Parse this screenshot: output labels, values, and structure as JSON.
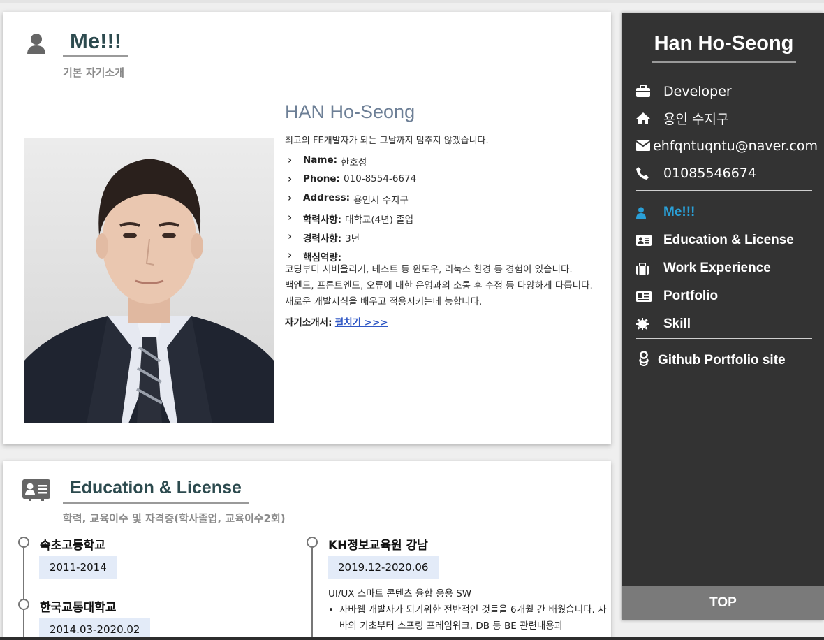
{
  "me_section": {
    "title": "Me!!!",
    "subtitle": "기본 자기소개",
    "intro_name": "HAN Ho-Seong",
    "motto": "최고의 FE개발자가 되는 그날까지 멈추지 않겠습니다.",
    "facts": [
      {
        "key": "Name:",
        "value": "한호성"
      },
      {
        "key": "Phone:",
        "value": "010-8554-6674"
      },
      {
        "key": "Address:",
        "value": "용인시 수지구"
      },
      {
        "key": "학력사항:",
        "value": "대학교(4년) 졸업"
      },
      {
        "key": "경력사항:",
        "value": "3년"
      },
      {
        "key": "핵심역량:",
        "value": ""
      }
    ],
    "core_lines": [
      "코딩부터 서버올리기, 테스트 등 윈도우, 리눅스 환경 등 경험이 있습니다.",
      "백엔드, 프론트엔드, 오류에 대한 운영과의 소통 후 수정 등 다양하게 다룹니다.",
      "새로운 개발지식을 배우고 적용시키는데 능합니다."
    ],
    "self_intro_label": "자기소개서:",
    "self_intro_link": "펼치기 >>>"
  },
  "edu_section": {
    "title": "Education & License",
    "subtitle": "학력, 교육이수 및 자격증(학사졸업, 교육이수2회)",
    "left_items": [
      {
        "title": "속초고등학교",
        "date": "2011-2014"
      },
      {
        "title": "한국교통대학교",
        "date": "2014.03-2020.02"
      }
    ],
    "right_items": [
      {
        "title": "KH정보교육원 강남",
        "date": "2019.12-2020.06",
        "course": "UI/UX 스마트 콘텐츠 융합 응용 SW",
        "bullet": "자바웹 개발자가 되기위한 전반적인 것들을 6개월 간 배웠습니다. 자바의 기초부터 스프링 프레임워크, DB 등 BE 관련내용과"
      }
    ]
  },
  "sidebar": {
    "name": "Han Ho-Seong",
    "info": [
      {
        "icon": "briefcase-icon",
        "text": "Developer"
      },
      {
        "icon": "home-icon",
        "text": "용인 수지구"
      },
      {
        "icon": "envelope-icon",
        "text": "ehfqntuqntu@naver.com"
      },
      {
        "icon": "phone-icon",
        "text": "01085546674"
      }
    ],
    "nav": [
      {
        "icon": "user-icon",
        "label": "Me!!!",
        "active": true
      },
      {
        "icon": "id-card-icon",
        "label": "Education & License",
        "active": false
      },
      {
        "icon": "suitcase-icon",
        "label": "Work Experience",
        "active": false
      },
      {
        "icon": "newspaper-icon",
        "label": "Portfolio",
        "active": false
      },
      {
        "icon": "gear-icon",
        "label": "Skill",
        "active": false
      }
    ],
    "github_label": "Github Portfolio site",
    "top_button": "TOP"
  },
  "colors": {
    "sidebar_bg": "#333333",
    "active_nav": "#2a9fd6",
    "title_color": "#2c4a4e",
    "date_badge": "#e3ebf8",
    "link": "#2f57c4"
  }
}
